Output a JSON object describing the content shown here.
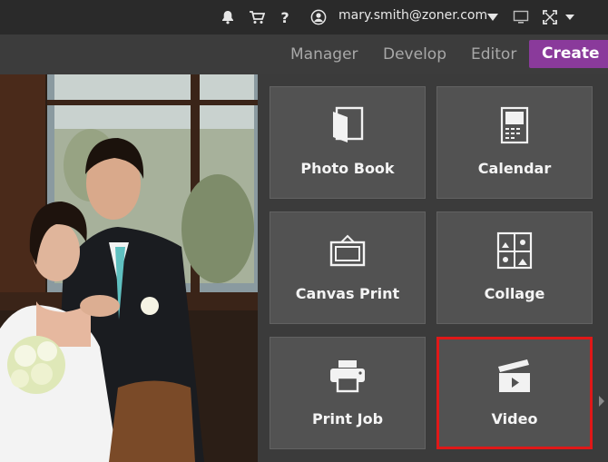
{
  "account": {
    "email": "mary.smith@zoner.com"
  },
  "topbar_icons": [
    "notifications-bell-icon",
    "cart-icon",
    "help-icon",
    "user-icon",
    "dropdown-icon",
    "monitor-icon",
    "fullscreen-icon",
    "dropdown-icon"
  ],
  "tabs": [
    {
      "label": "Manager"
    },
    {
      "label": "Develop"
    },
    {
      "label": "Editor"
    },
    {
      "label": "Create",
      "active": true
    }
  ],
  "create_tiles": [
    {
      "label": "Photo Book",
      "icon": "photo-book-icon"
    },
    {
      "label": "Calendar",
      "icon": "calendar-icon"
    },
    {
      "label": "Canvas Print",
      "icon": "canvas-print-icon"
    },
    {
      "label": "Collage",
      "icon": "collage-icon"
    },
    {
      "label": "Print Job",
      "icon": "printer-icon"
    },
    {
      "label": "Video",
      "icon": "video-clapper-icon",
      "highlighted": true
    }
  ],
  "colors": {
    "accent_create": "#8a3a9b",
    "highlight": "#e01818",
    "tile_bg": "#525252"
  }
}
